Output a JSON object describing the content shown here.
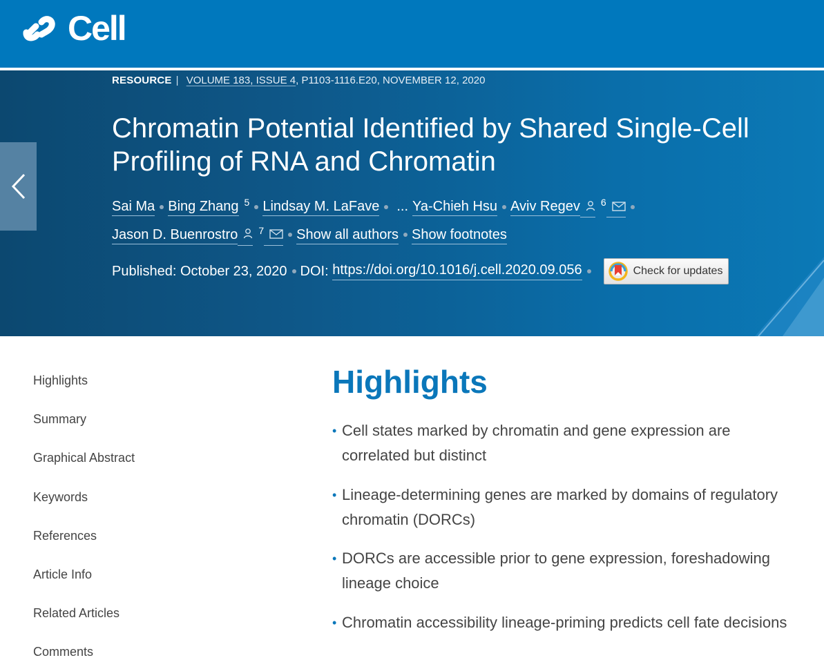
{
  "brand": {
    "name": "Cell"
  },
  "article": {
    "type": "RESOURCE",
    "volume_issue": "VOLUME 183, ISSUE 4",
    "pages_date": "P1103-1116.E20, NOVEMBER 12, 2020",
    "title": "Chromatin Potential Identified by Shared Single-Cell Profiling of RNA and Chromatin",
    "authors": {
      "a1": "Sai Ma",
      "a2": "Bing Zhang",
      "a2_sup": "5",
      "a3": "Lindsay M. LaFave",
      "ellipsis": "...",
      "a4": "Ya-Chieh Hsu",
      "a5": "Aviv Regev",
      "a5_sup": "6",
      "a6": "Jason D. Buenrostro",
      "a6_sup": "7",
      "show_all": "Show all authors",
      "show_footnotes": "Show footnotes"
    },
    "published_label": "Published: October 23, 2020",
    "doi_label": "DOI:",
    "doi_link": "https://doi.org/10.1016/j.cell.2020.09.056",
    "check_updates": "Check for updates"
  },
  "sidenav": {
    "items": [
      "Highlights",
      "Summary",
      "Graphical Abstract",
      "Keywords",
      "References",
      "Article Info",
      "Related Articles",
      "Comments"
    ]
  },
  "highlights": {
    "title": "Highlights",
    "items": [
      "Cell states marked by chromatin and gene expression are correlated but distinct",
      "Lineage-determining genes are marked by domains of regulatory chromatin (DORCs)",
      "DORCs are accessible prior to gene expression, foreshadowing lineage choice",
      "Chromatin accessibility lineage-priming predicts cell fate decisions"
    ]
  },
  "colors": {
    "brand_blue": "#0078bd",
    "hero_dark": "#0c4870",
    "accent": "#0a77ba"
  }
}
